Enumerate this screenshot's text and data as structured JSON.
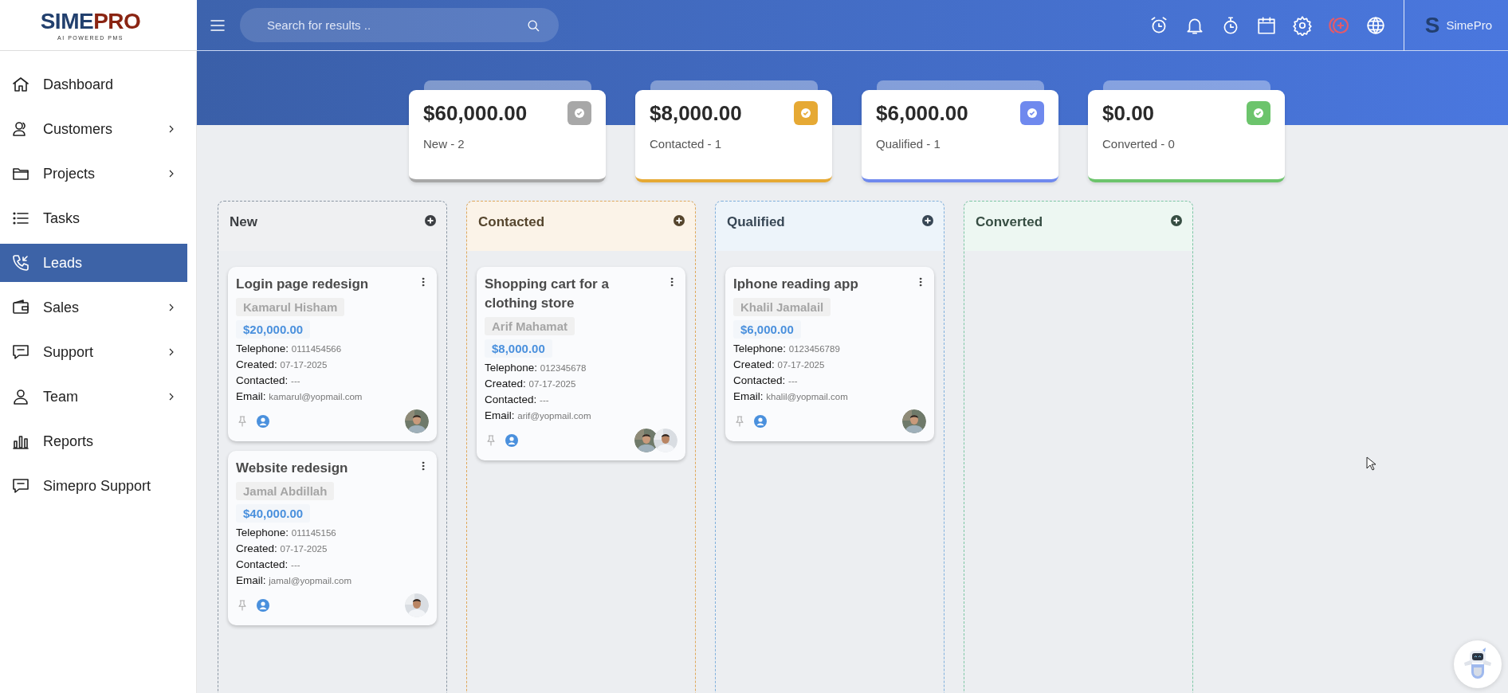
{
  "logo": {
    "brand_first": "SIME",
    "brand_second": "PRO",
    "tagline": "AI POWERED PMS"
  },
  "search": {
    "placeholder": "Search for results .."
  },
  "user": {
    "initial": "S",
    "name": "SimePro"
  },
  "sidebar": {
    "items": [
      {
        "label": "Dashboard",
        "selected": false,
        "expandable": false
      },
      {
        "label": "Customers",
        "selected": false,
        "expandable": true
      },
      {
        "label": "Projects",
        "selected": false,
        "expandable": true
      },
      {
        "label": "Tasks",
        "selected": false,
        "expandable": false
      },
      {
        "label": "Leads",
        "selected": true,
        "expandable": false
      },
      {
        "label": "Sales",
        "selected": false,
        "expandable": true
      },
      {
        "label": "Support",
        "selected": false,
        "expandable": true
      },
      {
        "label": "Team",
        "selected": false,
        "expandable": true
      },
      {
        "label": "Reports",
        "selected": false,
        "expandable": false
      },
      {
        "label": "Simepro Support",
        "selected": false,
        "expandable": false
      }
    ]
  },
  "summary_cards": [
    {
      "amount": "$60,000.00",
      "label": "New - 2",
      "color": "#a8a8a8"
    },
    {
      "amount": "$8,000.00",
      "label": "Contacted - 1",
      "color": "#e6a934"
    },
    {
      "amount": "$6,000.00",
      "label": "Qualified - 1",
      "color": "#6f89ee"
    },
    {
      "amount": "$0.00",
      "label": "Converted - 0",
      "color": "#6cc46c"
    }
  ],
  "columns": [
    {
      "title": "New",
      "color": "#8a96a3",
      "cards": [
        {
          "title": "Login page redesign",
          "contact": "Kamarul Hisham",
          "amount": "$20,000.00",
          "fields": [
            {
              "label": "Telephone:",
              "value": "0111454566"
            },
            {
              "label": "Created:",
              "value": "07-17-2025"
            },
            {
              "label": "Contacted:",
              "value": "---"
            },
            {
              "label": "Email:",
              "value": "kamarul@yopmail.com"
            }
          ]
        },
        {
          "title": "Website redesign",
          "contact": "Jamal Abdillah",
          "amount": "$40,000.00",
          "fields": [
            {
              "label": "Telephone:",
              "value": "011145156"
            },
            {
              "label": "Created:",
              "value": "07-17-2025"
            },
            {
              "label": "Contacted:",
              "value": "---"
            },
            {
              "label": "Email:",
              "value": "jamal@yopmail.com"
            }
          ]
        }
      ]
    },
    {
      "title": "Contacted",
      "color": "#e0a85a",
      "cards": [
        {
          "title": "Shopping cart for a clothing store",
          "contact": "Arif Mahamat",
          "amount": "$8,000.00",
          "fields": [
            {
              "label": "Telephone:",
              "value": "012345678"
            },
            {
              "label": "Created:",
              "value": "07-17-2025"
            },
            {
              "label": "Contacted:",
              "value": "---"
            },
            {
              "label": "Email:",
              "value": "arif@yopmail.com"
            }
          ]
        }
      ]
    },
    {
      "title": "Qualified",
      "color": "#7fb0dd",
      "cards": [
        {
          "title": "Iphone reading app",
          "contact": "Khalil Jamalail",
          "amount": "$6,000.00",
          "fields": [
            {
              "label": "Telephone:",
              "value": "0123456789"
            },
            {
              "label": "Created:",
              "value": "07-17-2025"
            },
            {
              "label": "Contacted:",
              "value": "---"
            },
            {
              "label": "Email:",
              "value": "khalil@yopmail.com"
            }
          ]
        }
      ]
    },
    {
      "title": "Converted",
      "color": "#7cc7a4"
    }
  ]
}
